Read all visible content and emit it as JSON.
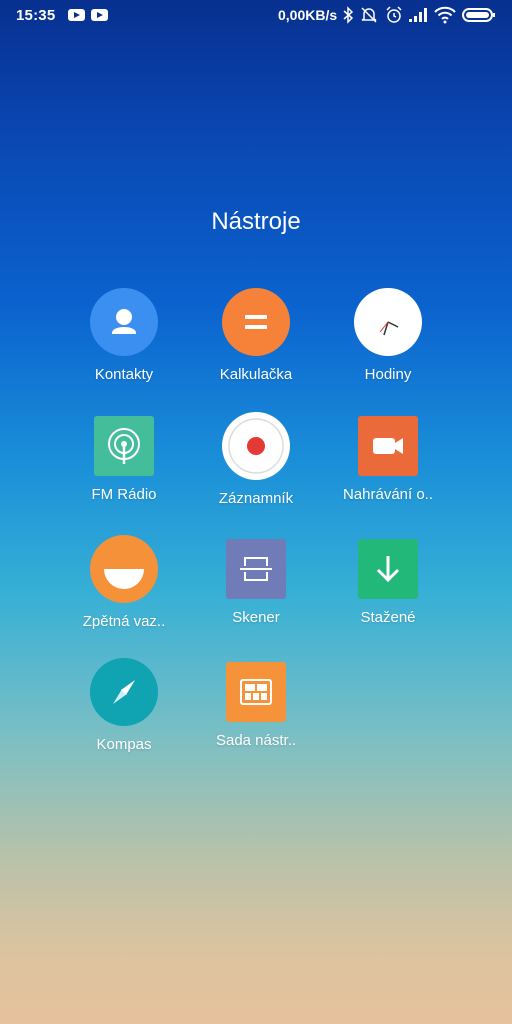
{
  "status_bar": {
    "time": "15:35",
    "net_speed": "0,00KB/s",
    "icons": [
      "youtube-icon",
      "youtube-icon",
      "bluetooth-icon",
      "dnd-off-icon",
      "alarm-icon",
      "signal-icon",
      "wifi-icon",
      "battery-icon"
    ]
  },
  "folder": {
    "title": "Nástroje",
    "apps": [
      {
        "label": "Kontakty",
        "icon": "contacts-icon",
        "color": "#3a8ff0"
      },
      {
        "label": "Kalkulačka",
        "icon": "calculator-icon",
        "color": "#f6823a"
      },
      {
        "label": "Hodiny",
        "icon": "clock-icon",
        "color": "#ffffff"
      },
      {
        "label": "FM Rádio",
        "icon": "fm-radio-icon",
        "color": "#43bd9a"
      },
      {
        "label": "Záznamník",
        "icon": "recorder-icon",
        "color": "#ffffff"
      },
      {
        "label": "Nahrávání o..",
        "icon": "screen-recorder-icon",
        "color": "#ea6a3a"
      },
      {
        "label": "Zpětná vaz..",
        "icon": "feedback-icon",
        "color": "#f59138"
      },
      {
        "label": "Skener",
        "icon": "scanner-icon",
        "color": "#6f7cb8"
      },
      {
        "label": "Stažené",
        "icon": "downloads-icon",
        "color": "#21b87a"
      },
      {
        "label": "Kompas",
        "icon": "compass-icon",
        "color": "#10a3b2"
      },
      {
        "label": "Sada nástr..",
        "icon": "toolkit-icon",
        "color": "#f6923a"
      }
    ]
  }
}
